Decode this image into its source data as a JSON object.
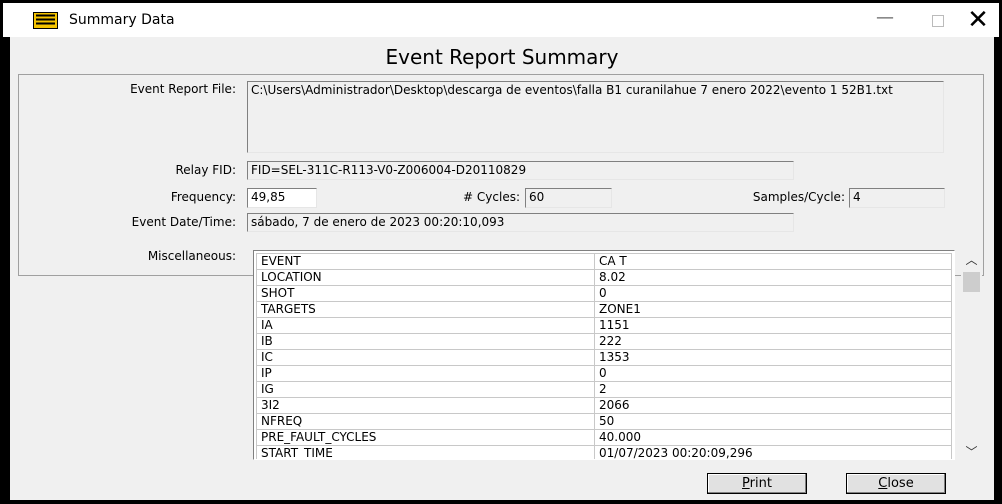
{
  "window": {
    "title": "Summary Data",
    "icon": "summary-document-icon",
    "controls": {
      "minimize": "—",
      "maximize": "☐",
      "close": "✕"
    }
  },
  "report": {
    "heading": "Event Report Summary",
    "labels": {
      "event_report_file": "Event Report File:",
      "relay_fid": "Relay FID:",
      "frequency": "Frequency:",
      "cycles": "# Cycles:",
      "samples_per_cycle": "Samples/Cycle:",
      "event_datetime": "Event Date/Time:",
      "miscellaneous": "Miscellaneous:"
    },
    "values": {
      "event_report_file": "C:\\Users\\Administrador\\Desktop\\descarga de eventos\\falla B1 curanilahue 7 enero 2022\\evento 1 52B1.txt",
      "relay_fid": "FID=SEL-311C-R113-V0-Z006004-D20110829",
      "frequency": "49,85",
      "cycles": "60",
      "samples_per_cycle": "4",
      "event_datetime": "sábado, 7 de enero de 2023  00:20:10,093"
    },
    "miscellaneous": [
      {
        "key": "EVENT",
        "value": "CA T"
      },
      {
        "key": "LOCATION",
        "value": "8.02"
      },
      {
        "key": "SHOT",
        "value": "0"
      },
      {
        "key": "TARGETS",
        "value": "ZONE1"
      },
      {
        "key": "IA",
        "value": "1151"
      },
      {
        "key": "IB",
        "value": "222"
      },
      {
        "key": "IC",
        "value": "1353"
      },
      {
        "key": "IP",
        "value": "0"
      },
      {
        "key": "IG",
        "value": "2"
      },
      {
        "key": "3I2",
        "value": "2066"
      },
      {
        "key": "NFREQ",
        "value": "50"
      },
      {
        "key": "PRE_FAULT_CYCLES",
        "value": "40.000"
      },
      {
        "key": "START_TIME",
        "value": "01/07/2023 00:20:09,296"
      }
    ]
  },
  "buttons": {
    "print": "Print",
    "print_accel": "P",
    "close": "Close",
    "close_accel": "C"
  },
  "colors": {
    "frame": "#000000",
    "dialog_bg": "#f0f0f0",
    "icon_yellow": "#f5c400"
  }
}
